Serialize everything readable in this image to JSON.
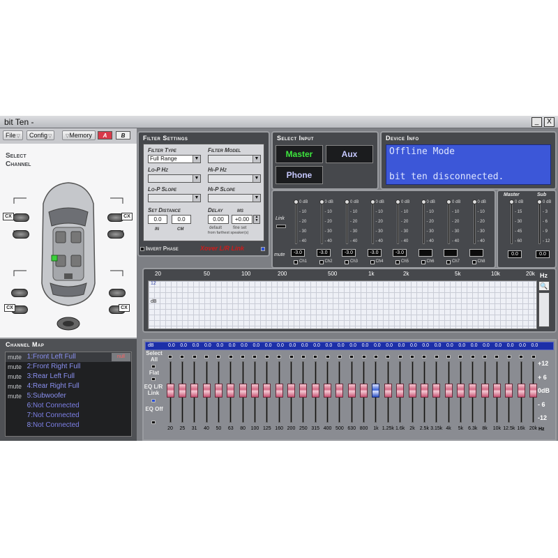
{
  "app": {
    "title": "bit Ten -",
    "minimize": "_",
    "close": "X"
  },
  "menu": {
    "file": "File",
    "config": "Config",
    "memory": "Memory",
    "a": "A",
    "b": "B"
  },
  "select_channel": {
    "title_line1": "Select",
    "title_line2": "Channel",
    "cx": "CX"
  },
  "channel_map": {
    "title": "Channel Map",
    "badge": "null",
    "rows": [
      {
        "mute": "mute",
        "num": "1:",
        "name": "Front Left Full"
      },
      {
        "mute": "mute",
        "num": "2:",
        "name": "Front Right Full"
      },
      {
        "mute": "mute",
        "num": "3:",
        "name": "Rear Left Full"
      },
      {
        "mute": "mute",
        "num": "4:",
        "name": "Rear Right Full"
      },
      {
        "mute": "mute",
        "num": "5:",
        "name": "Subwoofer"
      },
      {
        "mute": "",
        "num": "6:",
        "name": "Not Connected"
      },
      {
        "mute": "",
        "num": "7:",
        "name": "Not Connected"
      },
      {
        "mute": "",
        "num": "8:",
        "name": "Not Connected"
      }
    ]
  },
  "filter": {
    "title": "Filter Settings",
    "filter_type_label": "Filter Type",
    "filter_type_value": "Full Range",
    "filter_model_label": "Filter Model",
    "lop_label": "Lo-P Hz",
    "hip_label": "Hi-P Hz",
    "lop_slope_label": "Lo-P Slope",
    "hip_slope_label": "Hi-P Slope",
    "set_distance_label": "Set Distance",
    "delay_label": "Delay",
    "ms_label": "ms",
    "dist_in": "0.0",
    "dist_cm": "0.0",
    "in_label": "in",
    "cm_label": "cm",
    "delay_default": "0.00",
    "delay_fine": "+0.00",
    "default_label": "default",
    "fine_label": "fine set",
    "farthest_label": "from farthest speaker(s)",
    "invert_phase": "Invert Phase",
    "xover_link": "Xover L/R Link"
  },
  "select_input": {
    "title": "Select Input",
    "master": "Master",
    "aux": "Aux",
    "phone": "Phone"
  },
  "device_info": {
    "title": "Device Info",
    "line1": "Offline Mode",
    "line2": "bit ten disconnected."
  },
  "levels": {
    "link": "Link",
    "mute": "mute",
    "ticks": [
      "0 dB",
      "- 10",
      "- 20",
      "- 30",
      "- 40"
    ],
    "channels": [
      {
        "label": "Ch1",
        "value": "-3.0"
      },
      {
        "label": "Ch2",
        "value": "-3.0"
      },
      {
        "label": "Ch3",
        "value": "-3.0"
      },
      {
        "label": "Ch4",
        "value": "-3.0"
      },
      {
        "label": "Ch5",
        "value": "-3.0"
      },
      {
        "label": "Ch6",
        "value": ""
      },
      {
        "label": "Ch7",
        "value": ""
      },
      {
        "label": "Ch8",
        "value": ""
      }
    ],
    "master_label": "Master",
    "sub_label": "Sub",
    "master_ticks": [
      "0 dB",
      "- 15",
      "- 30",
      "- 45",
      "- 60"
    ],
    "sub_ticks": [
      "0 dB",
      "- 3",
      "- 6",
      "- 9",
      "- 12"
    ],
    "master_value": "0.0",
    "sub_value": "0.0"
  },
  "graph": {
    "freq_labels": [
      "20",
      "50",
      "100",
      "200",
      "500",
      "1k",
      "2k",
      "5k",
      "10k",
      "20k"
    ],
    "hz": "Hz",
    "y_top": "12",
    "y_label": "dB"
  },
  "eq": {
    "db_label": "dB",
    "values": [
      "0.0",
      "0.0",
      "0.0",
      "0.0",
      "0.0",
      "0.0",
      "0.0",
      "0.0",
      "0.0",
      "0.0",
      "0.0",
      "0.0",
      "0.0",
      "0.0",
      "0.0",
      "0.0",
      "0.0",
      "0.0",
      "0.0",
      "0.0",
      "0.0",
      "0.0",
      "0.0",
      "0.0",
      "0.0",
      "0.0",
      "0.0",
      "0.0",
      "0.0",
      "0.0",
      "0.0"
    ],
    "freqs": [
      "20",
      "25",
      "31",
      "40",
      "50",
      "63",
      "80",
      "100",
      "125",
      "160",
      "200",
      "250",
      "315",
      "400",
      "500",
      "630",
      "800",
      "1k",
      "1.25k",
      "1.6k",
      "2k",
      "2.5k",
      "3.15k",
      "4k",
      "5k",
      "6.3k",
      "8k",
      "10k",
      "12.5k",
      "16k",
      "20k"
    ],
    "selected_index": 17,
    "select_all": "Select All",
    "flat": "Flat",
    "eq_lr_link": "EQ L/R Link",
    "eq_off": "EQ Off",
    "scale": [
      "+12",
      "+ 6",
      "0dB",
      "- 6",
      "-12"
    ],
    "hz": "Hz"
  }
}
